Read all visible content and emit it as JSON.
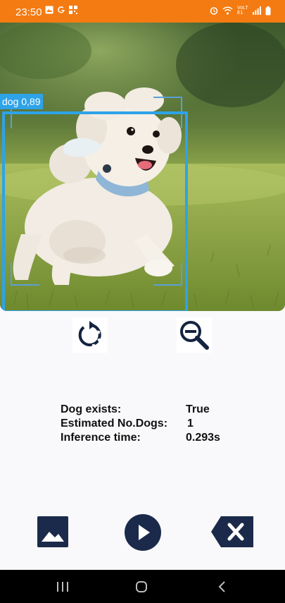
{
  "status_bar": {
    "time": "23:50",
    "left_icons": [
      "gallery-icon",
      "google-icon",
      "qr-icon"
    ],
    "right_icons": [
      "alarm-icon",
      "wifi-icon",
      "volte-icon",
      "signal-icon",
      "battery-icon"
    ],
    "network_label": "VoLTE1",
    "background": "#f47b12"
  },
  "detection": {
    "label": "dog 0,89",
    "box_color": "#2ea3e8"
  },
  "controls": {
    "rotate_icon": "rotate-icon",
    "zoom_out_icon": "zoom-out-icon"
  },
  "results": {
    "rows": [
      {
        "label": "Dog exists:",
        "value": "True"
      },
      {
        "label": "Estimated No.Dogs:",
        "value": "1"
      },
      {
        "label": "Inference time:",
        "value": "0.293s"
      }
    ]
  },
  "actions": {
    "gallery_icon": "image-icon",
    "run_icon": "play-icon",
    "clear_icon": "backspace-clear-icon",
    "accent": "#1b2a4a"
  },
  "nav": {
    "icons": [
      "recent-apps-icon",
      "home-icon",
      "back-icon"
    ]
  }
}
